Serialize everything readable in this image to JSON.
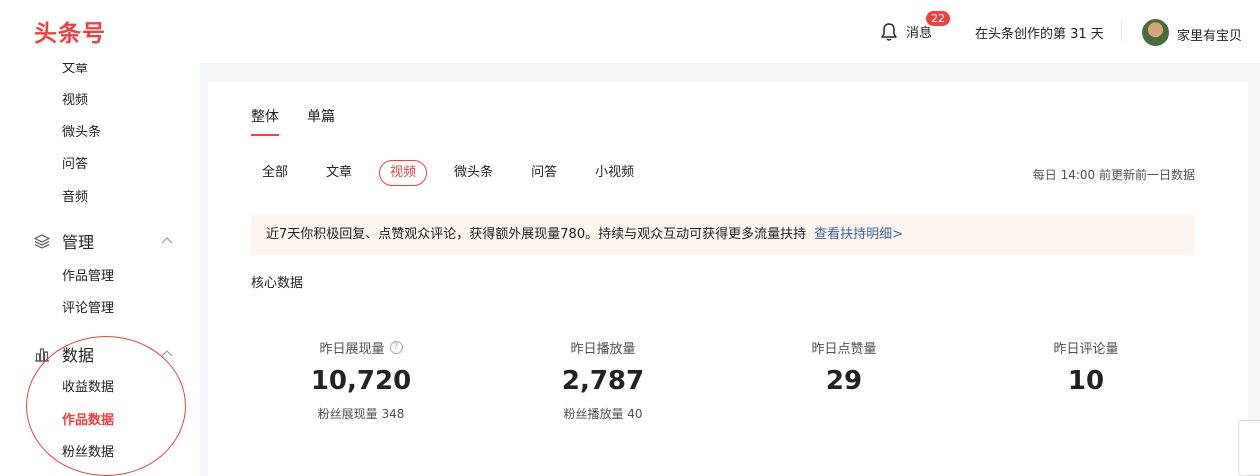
{
  "header": {
    "logo": "头条号",
    "message_label": "消息",
    "message_badge": "22",
    "days_text": "在头条创作的第 31 天",
    "username": "家里有宝贝"
  },
  "sidebar": {
    "content_items": [
      "文章",
      "视频",
      "微头条",
      "问答",
      "音频"
    ],
    "manage": {
      "label": "管理",
      "items": [
        "作品管理",
        "评论管理"
      ]
    },
    "data": {
      "label": "数据",
      "items": [
        "收益数据",
        "作品数据",
        "粉丝数据"
      ],
      "active": "作品数据"
    }
  },
  "main": {
    "tabs": [
      "整体",
      "单篇"
    ],
    "active_tab": "整体",
    "filters": [
      "全部",
      "文章",
      "视频",
      "微头条",
      "问答",
      "小视频"
    ],
    "active_filter": "视频",
    "update_note": "每日 14:00 前更新前一日数据",
    "notice_text": "近7天你积极回复、点赞观众评论，获得额外展现量780。持续与观众互动可获得更多流量扶持",
    "notice_link": "查看扶持明细>",
    "core_title": "核心数据",
    "stats": [
      {
        "label": "昨日展现量",
        "value": "10,720",
        "sub": "粉丝展现量 348",
        "help": true
      },
      {
        "label": "昨日播放量",
        "value": "2,787",
        "sub": "粉丝播放量 40",
        "help": false
      },
      {
        "label": "昨日点赞量",
        "value": "29",
        "sub": "",
        "help": false
      },
      {
        "label": "昨日评论量",
        "value": "10",
        "sub": "",
        "help": false
      }
    ]
  },
  "colors": {
    "brand": "#f04142",
    "link": "#406599",
    "notice_bg": "#fdf5ef"
  }
}
